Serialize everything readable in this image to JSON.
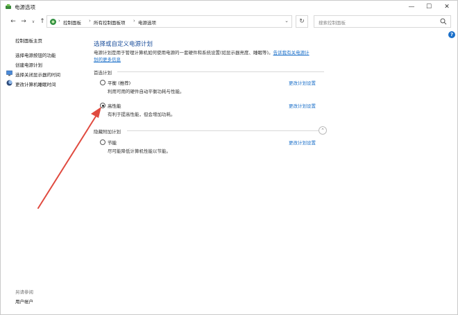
{
  "window": {
    "title": "电源选项",
    "controls": {
      "minimize": "—",
      "maximize": "☐",
      "close": "✕"
    }
  },
  "nav": {
    "back": "←",
    "forward": "→",
    "recent": "∨",
    "up": "↑",
    "breadcrumbs": [
      "控制面板",
      "所有控制面板项",
      "电源选项"
    ],
    "separator": "›",
    "refresh": "↻",
    "search_placeholder": "搜索控制面板"
  },
  "help": "?",
  "sidebar": {
    "home": "控制面板主页",
    "links": [
      "选择电源按钮的功能",
      "创建电源计划",
      "选择关闭显示器的时间",
      "更改计算机睡眠时间"
    ],
    "see_also": "另请参阅",
    "user_accounts": "用户帐户"
  },
  "main": {
    "title": "选择或自定义电源计划",
    "description": "电源计划是用于管理计算机如何使用电源的一套硬件和系统设置(如显示器亮度、睡眠等)。",
    "description_link_a": "告诉我有关电源计",
    "description_link_b": "划的更多信息",
    "preferred_header": "首选计划",
    "hidden_header": "隐藏附加计划",
    "change_label": "更改计划设置",
    "plans": [
      {
        "name": "平衡 (推荐)",
        "desc": "利用可用的硬件自动平衡功耗与性能。",
        "selected": false
      },
      {
        "name": "高性能",
        "desc": "有利于提高性能，但会增加功耗。",
        "selected": true
      },
      {
        "name": "节能",
        "desc": "尽可能降低计算机性能以节能。",
        "selected": false
      }
    ]
  },
  "annotation": {
    "arrow_color": "#e04a3f"
  }
}
